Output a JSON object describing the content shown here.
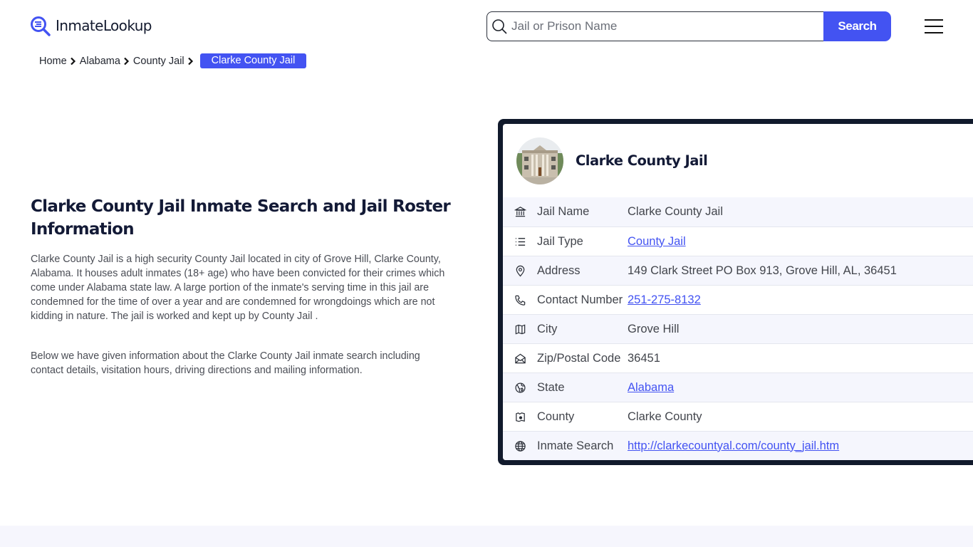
{
  "header": {
    "logo_text": "InmateLookup",
    "search_placeholder": "Jail or Prison Name",
    "search_value": "",
    "search_button": "Search",
    "menu_icon": "hamburger-menu-icon"
  },
  "breadcrumb": {
    "items": [
      "Home",
      "Alabama",
      "County Jail"
    ],
    "current": "Clarke County Jail"
  },
  "main": {
    "title": "Clarke County Jail Inmate Search and Jail Roster Information",
    "paragraphs": [
      "Clarke County Jail is a high security County Jail located in city of Grove Hill, Clarke County, Alabama. It houses adult inmates (18+ age) who have been convicted for their crimes which come under Alabama state law. A large portion of the inmate's serving time in this jail are condemned for the time of over a year and are condemned for wrongdoings which are not kidding in nature. The jail is worked and kept up by County Jail .",
      "Below we have given information about the Clarke County Jail inmate search including contact details, visitation hours, driving directions and mailing information."
    ]
  },
  "card": {
    "title": "Clarke County Jail",
    "rows": [
      {
        "icon": "building-columns-icon",
        "label": "Jail Name",
        "value": "Clarke County Jail",
        "link": false
      },
      {
        "icon": "list-icon",
        "label": "Jail Type",
        "value": "County Jail",
        "link": true
      },
      {
        "icon": "map-pin-icon",
        "label": "Address",
        "value": "149 Clark Street PO Box 913, Grove Hill, AL, 36451",
        "link": false
      },
      {
        "icon": "phone-icon",
        "label": "Contact Number",
        "value": "251-275-8132",
        "link": true
      },
      {
        "icon": "map-icon",
        "label": "City",
        "value": "Grove Hill",
        "link": false
      },
      {
        "icon": "mail-open-icon",
        "label": "Zip/Postal Code",
        "value": "36451",
        "link": false
      },
      {
        "icon": "globe-region-icon",
        "label": "State",
        "value": "Alabama",
        "link": true
      },
      {
        "icon": "county-map-icon",
        "label": "County",
        "value": "Clarke County",
        "link": false
      },
      {
        "icon": "world-icon",
        "label": "Inmate Search",
        "value": "http://clarkecountyal.com/county_jail.htm",
        "link": true
      }
    ]
  },
  "colors": {
    "brand": "#4353f2",
    "dark": "#111a2c",
    "row_alt": "#f5f6fd"
  }
}
